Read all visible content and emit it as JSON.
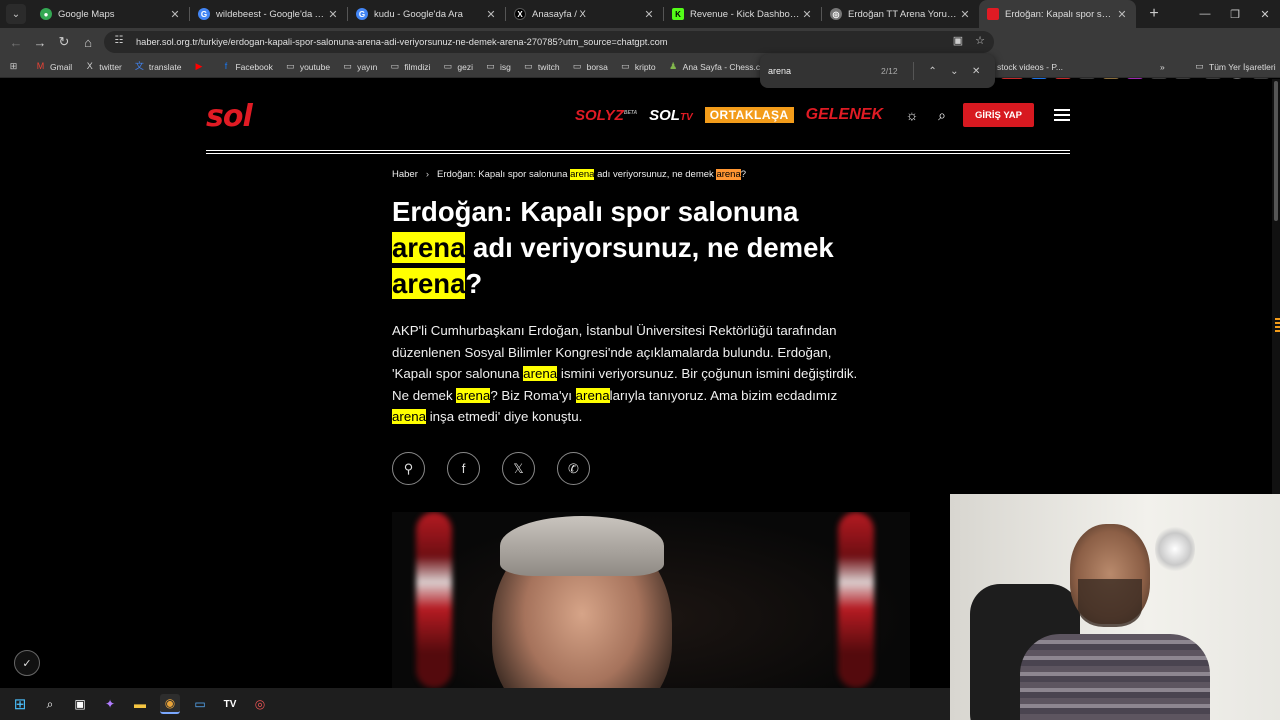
{
  "browser": {
    "tabs": [
      {
        "title": "Google Maps",
        "color": "#34a853",
        "glyph": "●"
      },
      {
        "title": "wildebeest - Google'da Ara",
        "color": "#4285f4",
        "glyph": "G"
      },
      {
        "title": "kudu - Google'da Ara",
        "color": "#4285f4",
        "glyph": "G"
      },
      {
        "title": "Anasayfa / X",
        "color": "#000000",
        "glyph": "X"
      },
      {
        "title": "Revenue - Kick Dashboard",
        "color": "#53fc18",
        "glyph": "K"
      },
      {
        "title": "Erdoğan TT Arena Yorumu",
        "color": "#777777",
        "glyph": "◎"
      },
      {
        "title": "Erdoğan: Kapalı spor salonuna",
        "color": "#e01b24",
        "glyph": "■"
      }
    ],
    "url": "haber.sol.org.tr/turkiye/erdogan-kapali-spor-salonuna-arena-adi-veriyorsunuz-ne-demek-arena-270785?utm_source=chatgpt.com",
    "extension_badge": "23921",
    "bookmarks": [
      {
        "label": "Gmail",
        "icon": "gmail-icon"
      },
      {
        "label": "twitter",
        "icon": "x-icon"
      },
      {
        "label": "translate",
        "icon": "translate-icon"
      },
      {
        "label": "Facebook",
        "icon": "facebook-icon"
      },
      {
        "label": "youtube",
        "icon": "folder-icon"
      },
      {
        "label": "yayın",
        "icon": "folder-icon"
      },
      {
        "label": "filmdizi",
        "icon": "folder-icon"
      },
      {
        "label": "gezi",
        "icon": "folder-icon"
      },
      {
        "label": "isg",
        "icon": "folder-icon"
      },
      {
        "label": "twitch",
        "icon": "folder-icon"
      },
      {
        "label": "borsa",
        "icon": "folder-icon"
      },
      {
        "label": "kripto",
        "icon": "folder-icon"
      },
      {
        "label": "Ana Sayfa - Chess.c...",
        "icon": "chess-icon"
      }
    ],
    "bookmark_hidden": "stock videos - P...",
    "all_bookmarks": "Tüm Yer İşaretleri"
  },
  "find": {
    "query": "arena",
    "count": "2/12"
  },
  "site": {
    "logo": "sol",
    "brands": {
      "yz": "SOLYZ",
      "yz_beta": "BETA",
      "tv": "SOL",
      "tv_suffix": "TV",
      "ortaklasa": "ORTAKLAŞA",
      "gelenek": "GELENEK"
    },
    "login": "GİRİŞ YAP"
  },
  "article": {
    "breadcrumb_home": "Haber",
    "breadcrumb_parts": [
      "Erdoğan: Kapalı spor salonuna ",
      "arena",
      " adı veriyorsunuz, ne demek ",
      "arena",
      "?"
    ],
    "title_parts": [
      "Erdoğan: Kapalı spor salonuna ",
      "arena",
      " adı veriyorsunuz, ne demek ",
      "arena",
      "?"
    ],
    "lead_parts": [
      "AKP'li Cumhurbaşkanı Erdoğan, İstanbul Üniversitesi Rektörlüğü tarafından düzenlenen Sosyal Bilimler Kongresi'nde açıklamalarda bulundu. Erdoğan, 'Kapalı spor salonuna ",
      "arena",
      " ismini veriyorsunuz. Bir çoğunun ismini değiştirdik. Ne demek ",
      "arena",
      "? Biz Roma'yı ",
      "arena",
      "larıyla tanıyoruz. Ama bizim ecdadımız ",
      "arena",
      " inşa etmedi' diye konuştu."
    ],
    "share_icons": [
      "link-icon",
      "facebook-icon",
      "x-icon",
      "whatsapp-icon"
    ]
  },
  "colors": {
    "brand_red": "#e01b24",
    "find_highlight": "#ffff00",
    "find_current": "#ff9632",
    "ortaklasa": "#f39c1a"
  }
}
